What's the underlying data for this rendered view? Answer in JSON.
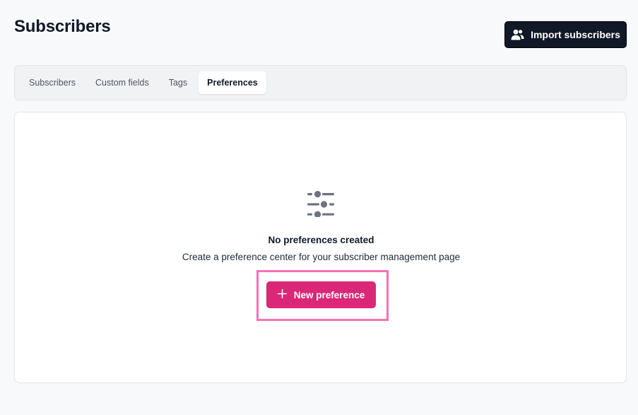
{
  "page": {
    "title": "Subscribers",
    "import_button_label": "Import subscribers",
    "import_icon": "users-icon"
  },
  "tabs": [
    {
      "label": "Subscribers",
      "active": false
    },
    {
      "label": "Custom fields",
      "active": false
    },
    {
      "label": "Tags",
      "active": false
    },
    {
      "label": "Preferences",
      "active": true
    }
  ],
  "empty_state": {
    "icon": "sliders-icon",
    "title": "No preferences created",
    "description": "Create a preference center for your subscriber management page",
    "button_label": "New preference",
    "button_icon": "plus-icon"
  },
  "colors": {
    "primary_button": "#db2777",
    "dark_button": "#111827",
    "highlight": "#f472b6"
  }
}
